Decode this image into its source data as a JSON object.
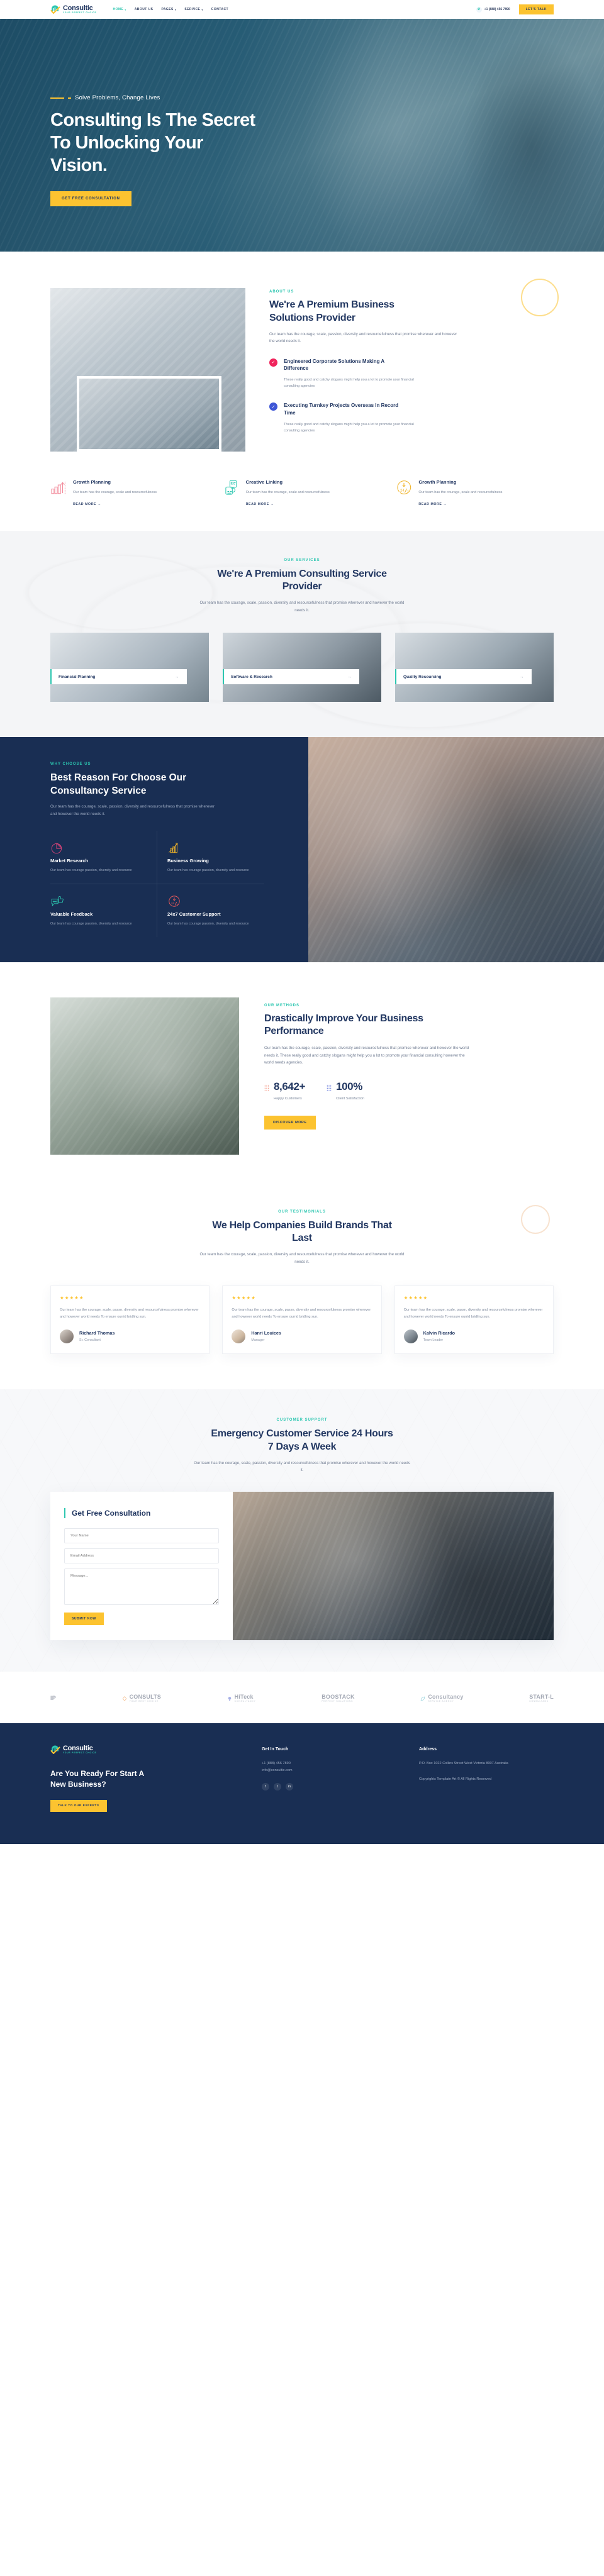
{
  "brand": {
    "name": "Consultic",
    "tagline": "YOUR PERFECT CHOICE"
  },
  "header": {
    "nav": [
      {
        "label": "HOME",
        "caret": "▾",
        "active": true
      },
      {
        "label": "ABOUT US",
        "caret": "",
        "active": false
      },
      {
        "label": "PAGES",
        "caret": "▾",
        "active": false
      },
      {
        "label": "SERVICE",
        "caret": "▾",
        "active": false
      },
      {
        "label": "CONTACT",
        "caret": "",
        "active": false
      }
    ],
    "phone": "+1 (888) 456 7890",
    "cta": "LET'S TALK"
  },
  "hero": {
    "eyebrow": "Solve Problems, Change Lives",
    "title": "Consulting Is The Secret To Unlocking Your Vision.",
    "cta": "GET FREE CONSULTATION"
  },
  "about": {
    "label": "ABOUT US",
    "title": "We're A Premium Business Solutions Provider",
    "text": "Our team has the courage, scale, passion, diversity and resourcefulness that promise wherever and however the world needs it.",
    "features": [
      {
        "title": "Engineered Corporate Solutions Making A Difference",
        "text": "These really good and catchy slogans might help you a lot to promote your financial consulting agencies",
        "color": "#f0245c"
      },
      {
        "title": "Executing Turnkey Projects Overseas In Record Time",
        "text": "These really good and catchy slogans might help you a lot to promote your financial consulting agencies",
        "color": "#3e56d6"
      }
    ],
    "mini_services": [
      {
        "title": "Growth Planning",
        "text": "Our team has the courage, scale and resourcefulness",
        "more": "READ MORE",
        "icon": "bar-chart-growth-icon",
        "color": "#f28a9a"
      },
      {
        "title": "Creative Linking",
        "text": "Our team has the courage, scale and resourcefulness",
        "more": "READ MORE",
        "icon": "link-card-icon",
        "color": "#2cc6b0"
      },
      {
        "title": "Growth Planning",
        "text": "Our team has the courage, scale and resourcefulness",
        "more": "READ MORE",
        "icon": "clock-24-7-icon",
        "color": "#f0b429"
      }
    ]
  },
  "services": {
    "label": "OUR SERVICES",
    "title": "We're A Premium Consulting Service Provider",
    "sub": "Our team has the courage, scale, passion, diversity and resourcefulness that promise wherever and however the world needs it.",
    "cards": [
      {
        "name": "Financial Planning",
        "arrow": "→"
      },
      {
        "name": "Software & Research",
        "arrow": "→"
      },
      {
        "name": "Quality Resourcing",
        "arrow": "→"
      }
    ]
  },
  "why": {
    "label": "WHY CHOOSE US",
    "title": "Best Reason For Choose Our Consultancy Service",
    "lead": "Our team has the courage, scale, passion, diversity and resourcefulness that promise wherever and however the world needs it.",
    "items": [
      {
        "title": "Market Research",
        "text": "Our team has courage passion, diversity and resource",
        "icon": "pie-chart-icon",
        "color": "#e0457b"
      },
      {
        "title": "Business Growing",
        "text": "Our team has courage passion, diversity and resource",
        "icon": "bar-chart-growth-icon",
        "color": "#f0b429"
      },
      {
        "title": "Valuable Feedback",
        "text": "Our team has courage passion, diversity and resource",
        "icon": "thumbs-up-chat-icon",
        "color": "#2cc6b0"
      },
      {
        "title": "24x7 Customer Support",
        "text": "Our team has courage passion, diversity and resource",
        "icon": "clock-24-7-icon",
        "color": "#ef5a5a"
      }
    ]
  },
  "methods": {
    "label": "OUR METHODS",
    "title": "Drastically Improve Your Business Performance",
    "text": "Our team has the courage, scale, passion, diversity and resourcefulness that promise wherever and however the world needs it. These really good and catchy slogans might help you a lot to promote your financial consulting however the world needs agencies.",
    "stats": [
      {
        "value": "8,642+",
        "label": "Happy Customers",
        "color": "#f2846f"
      },
      {
        "value": "100%",
        "label": "Client Satisfaction",
        "color": "#5a6fd8"
      }
    ],
    "cta": "DISCOVER MORE"
  },
  "testimonials": {
    "label": "OUR TESTIMONIALS",
    "title": "We Help Companies Build Brands That Last",
    "sub": "Our team has the courage, scale, passion, diversity and resourcefulness that promise wherever and however the world needs it.",
    "items": [
      {
        "stars": "★★★★★",
        "text": "Our team has the courage, scale, passn, diversity and resourcefulness promise wherever and however world needs To ensure ourrid bridling sun.",
        "name": "Richard Thomas",
        "role": "Sr. Consultant"
      },
      {
        "stars": "★★★★★",
        "text": "Our team has the courage, scale, passn, diversity and resourcefulness promise wherever and however world needs To ensure ourrid bridling sun.",
        "name": "Hanri Louices",
        "role": "Manager"
      },
      {
        "stars": "★★★★★",
        "text": "Our team has the courage, scale, passn, diversity and resourcefulness promise wherever and however world needs To ensure ourrid bridling sun.",
        "name": "Kalvin Ricardo",
        "role": "Team Leader"
      }
    ]
  },
  "contact": {
    "label": "CUSTOMER SUPPORT",
    "title": "Emergency Customer Service 24 Hours 7 Days A Week",
    "sub": "Our team has the courage, scale, passion, diversity and resourcefulness that promise wherever and however the world needs it.",
    "form": {
      "title": "Get Free Consultation",
      "name_placeholder": "Your Name",
      "email_placeholder": "Email Address",
      "message_placeholder": "Message...",
      "submit": "SUBMIT NOW"
    }
  },
  "clients": [
    {
      "name": "IP",
      "sub": ""
    },
    {
      "name": "CONSULTS",
      "sub": "YOUR BEST CHOICE"
    },
    {
      "name": "HiTeck",
      "sub": "Consultancy"
    },
    {
      "name": "BOOSTACK",
      "sub": "Perfect Solutions"
    },
    {
      "name": "Consultancy",
      "sub": "SERVICE AGENCY"
    },
    {
      "name": "START-L",
      "sub": "CONSULTANC"
    }
  ],
  "footer": {
    "brand": "Consultic",
    "tagline": "YOUR PERFECT CHOICE",
    "headline": "Are You Ready For Start A New Business?",
    "cta": "TALK TO OUR EXPERTS",
    "touch_title": "Get In Touch",
    "phone": "+1 (888) 456 7890",
    "email": "info@consultic.com",
    "address_title": "Address",
    "address": "P.O. Box 1022 Collins Street West Victoria 8007 Australia",
    "copyright": "Copyrights Template Art © All Rights Reserved",
    "social": [
      {
        "icon": "facebook-icon",
        "glyph": "f"
      },
      {
        "icon": "twitter-icon",
        "glyph": "t"
      },
      {
        "icon": "linkedin-icon",
        "glyph": "in"
      }
    ]
  },
  "colors": {
    "navy": "#192e53",
    "teal": "#2cc6b0",
    "yellow": "#fcc330",
    "heading": "#233862"
  }
}
